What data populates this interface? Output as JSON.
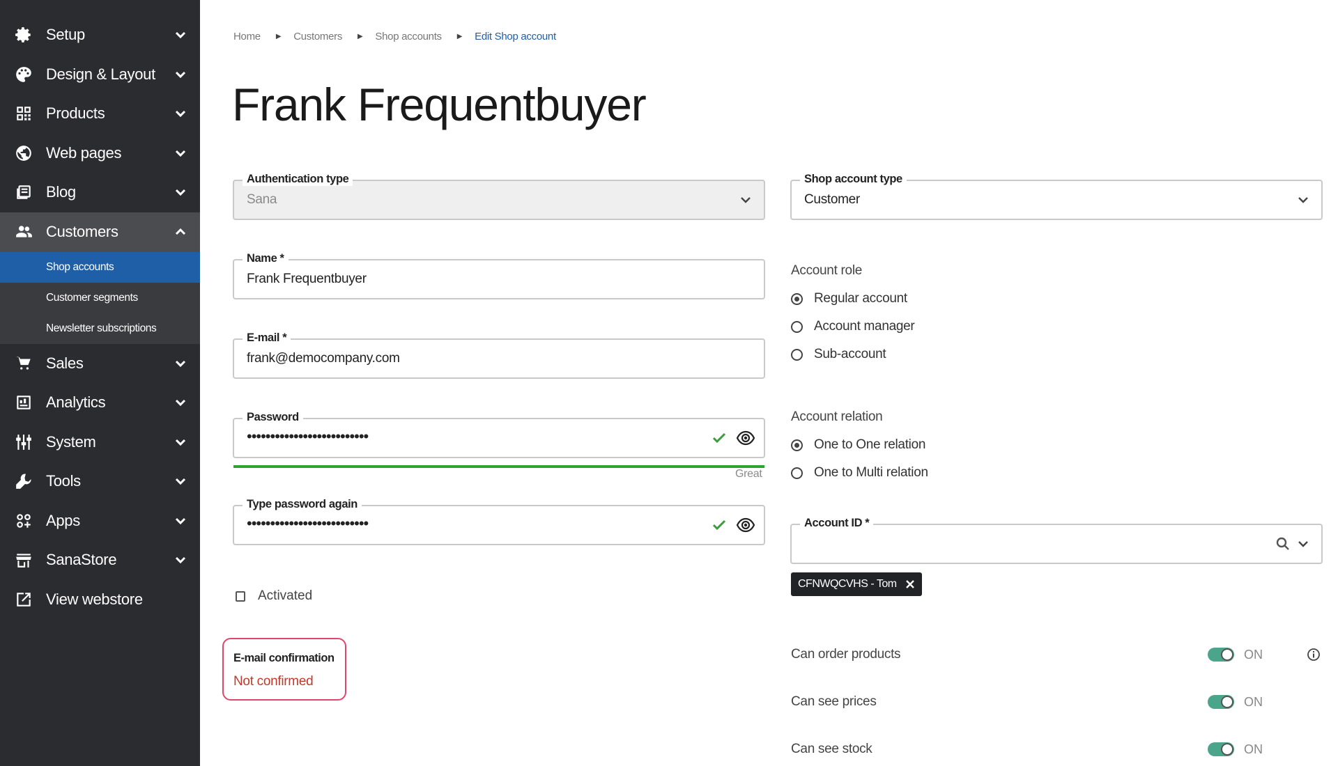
{
  "sidebar": {
    "items": [
      {
        "label": "Setup",
        "icon": "gear-icon"
      },
      {
        "label": "Design & Layout",
        "icon": "palette-icon"
      },
      {
        "label": "Products",
        "icon": "grid-icon"
      },
      {
        "label": "Web pages",
        "icon": "globe-icon"
      },
      {
        "label": "Blog",
        "icon": "blog-icon"
      },
      {
        "label": "Customers",
        "icon": "users-icon"
      },
      {
        "label": "Sales",
        "icon": "cart-icon"
      },
      {
        "label": "Analytics",
        "icon": "chart-icon"
      },
      {
        "label": "System",
        "icon": "sliders-icon"
      },
      {
        "label": "Tools",
        "icon": "wrench-icon"
      },
      {
        "label": "Apps",
        "icon": "apps-icon"
      },
      {
        "label": "SanaStore",
        "icon": "store-icon"
      },
      {
        "label": "View webstore",
        "icon": "external-link-icon"
      }
    ],
    "customers_sub": [
      {
        "label": "Shop accounts"
      },
      {
        "label": "Customer segments"
      },
      {
        "label": "Newsletter subscriptions"
      }
    ]
  },
  "breadcrumb": [
    "Home",
    "Customers",
    "Shop accounts",
    "Edit Shop account"
  ],
  "page_title": "Frank Frequentbuyer",
  "form": {
    "auth_type": {
      "legend": "Authentication type",
      "value": "Sana"
    },
    "name": {
      "legend": "Name *",
      "value": "Frank Frequentbuyer"
    },
    "email": {
      "legend": "E-mail *",
      "value": "frank@democompany.com"
    },
    "password": {
      "legend": "Password",
      "value": "••••••••••••••••••••••••••",
      "strength": "Great"
    },
    "password_again": {
      "legend": "Type password again",
      "value": "••••••••••••••••••••••••••"
    },
    "activated_label": "Activated",
    "email_confirmation": {
      "title": "E-mail confirmation",
      "value": "Not confirmed"
    }
  },
  "right": {
    "account_type": {
      "legend": "Shop account type",
      "value": "Customer"
    },
    "account_role": {
      "label": "Account role",
      "options": [
        "Regular account",
        "Account manager",
        "Sub-account"
      ],
      "selected": "Regular account"
    },
    "account_relation": {
      "label": "Account relation",
      "options": [
        "One to One relation",
        "One to Multi relation"
      ],
      "selected": "One to One relation"
    },
    "account_id": {
      "legend": "Account ID *",
      "chip": "CFNWQCVHS - Tom"
    },
    "toggles": [
      {
        "label": "Can order products",
        "state": "ON"
      },
      {
        "label": "Can see prices",
        "state": "ON"
      },
      {
        "label": "Can see stock",
        "state": "ON"
      }
    ]
  },
  "colors": {
    "sidebar_bg": "#2b2c30",
    "selected_sub": "#1f5fa8",
    "toggle_on": "#4aa58a",
    "error": "#c0392b",
    "strength": "#2fa32f"
  }
}
